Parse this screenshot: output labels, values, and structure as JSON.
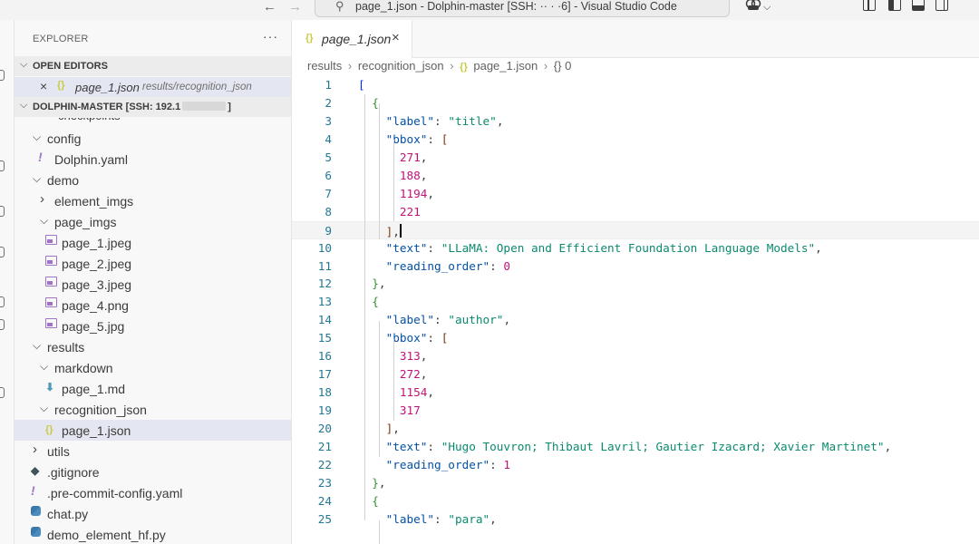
{
  "titlebar": {
    "back_icon": "←",
    "forward_icon": "→",
    "command_center": "page_1.json - Dolphin-master [SSH: ·· ·     ·6] - Visual Studio Code",
    "copilot_icon": "copilot-icon",
    "copilot_chevron": "⌵"
  },
  "explorer": {
    "title": "EXPLORER",
    "more_actions": "···",
    "open_editors": {
      "label": "OPEN EDITORS",
      "items": [
        {
          "name": "page_1.json",
          "path": "results/recognition_json",
          "icon": "{}"
        }
      ]
    },
    "workspace": {
      "label": "DOLPHIN-MASTER [SSH: 192.1",
      "clipped_item": "checkpoints",
      "tree": [
        {
          "name": "config",
          "kind": "folder",
          "open": true,
          "depth": 1
        },
        {
          "name": "Dolphin.yaml",
          "kind": "yaml",
          "depth": 2
        },
        {
          "name": "demo",
          "kind": "folder",
          "open": true,
          "depth": 1
        },
        {
          "name": "element_imgs",
          "kind": "folder",
          "open": false,
          "depth": 2
        },
        {
          "name": "page_imgs",
          "kind": "folder",
          "open": true,
          "depth": 2
        },
        {
          "name": "page_1.jpeg",
          "kind": "image",
          "depth": 3
        },
        {
          "name": "page_2.jpeg",
          "kind": "image",
          "depth": 3
        },
        {
          "name": "page_3.jpeg",
          "kind": "image",
          "depth": 3
        },
        {
          "name": "page_4.png",
          "kind": "image",
          "depth": 3
        },
        {
          "name": "page_5.jpg",
          "kind": "image",
          "depth": 3
        },
        {
          "name": "results",
          "kind": "folder",
          "open": true,
          "depth": 1
        },
        {
          "name": "markdown",
          "kind": "folder",
          "open": true,
          "depth": 2
        },
        {
          "name": "page_1.md",
          "kind": "markdown",
          "depth": 3
        },
        {
          "name": "recognition_json",
          "kind": "folder",
          "open": true,
          "depth": 2
        },
        {
          "name": "page_1.json",
          "kind": "json",
          "depth": 3,
          "selected": true
        },
        {
          "name": "utils",
          "kind": "folder",
          "open": false,
          "depth": 1
        },
        {
          "name": ".gitignore",
          "kind": "git",
          "depth": 1
        },
        {
          "name": ".pre-commit-config.yaml",
          "kind": "yaml",
          "depth": 1
        },
        {
          "name": "chat.py",
          "kind": "python",
          "depth": 1
        },
        {
          "name": "demo_element_hf.py",
          "kind": "python",
          "depth": 1
        }
      ]
    }
  },
  "editor": {
    "tab": {
      "label": "page_1.json",
      "icon": "{}",
      "close": "×"
    },
    "breadcrumb": [
      "results",
      "recognition_json",
      "page_1.json",
      "{} 0"
    ],
    "lines": [
      {
        "n": "1",
        "tokens": [
          [
            "b1",
            "["
          ]
        ]
      },
      {
        "n": "2",
        "tokens": [
          [
            "p",
            "  "
          ],
          [
            "b2",
            "{"
          ]
        ]
      },
      {
        "n": "3",
        "tokens": [
          [
            "p",
            "    "
          ],
          [
            "k",
            "\"label\""
          ],
          [
            "p",
            ": "
          ],
          [
            "s",
            "\"title\""
          ],
          [
            "p",
            ","
          ]
        ]
      },
      {
        "n": "4",
        "tokens": [
          [
            "p",
            "    "
          ],
          [
            "k",
            "\"bbox\""
          ],
          [
            "p",
            ": "
          ],
          [
            "b3",
            "["
          ]
        ]
      },
      {
        "n": "5",
        "tokens": [
          [
            "p",
            "      "
          ],
          [
            "n",
            "271"
          ],
          [
            "p",
            ","
          ]
        ]
      },
      {
        "n": "6",
        "tokens": [
          [
            "p",
            "      "
          ],
          [
            "n",
            "188"
          ],
          [
            "p",
            ","
          ]
        ]
      },
      {
        "n": "7",
        "tokens": [
          [
            "p",
            "      "
          ],
          [
            "n",
            "1194"
          ],
          [
            "p",
            ","
          ]
        ]
      },
      {
        "n": "8",
        "tokens": [
          [
            "p",
            "      "
          ],
          [
            "n",
            "221"
          ]
        ]
      },
      {
        "n": "9",
        "tokens": [
          [
            "p",
            "    "
          ],
          [
            "b3",
            "]"
          ],
          [
            "p",
            ","
          ]
        ],
        "current": true
      },
      {
        "n": "10",
        "tokens": [
          [
            "p",
            "    "
          ],
          [
            "k",
            "\"text\""
          ],
          [
            "p",
            ": "
          ],
          [
            "s",
            "\"LLaMA: Open and Efficient Foundation Language Models\""
          ],
          [
            "p",
            ","
          ]
        ]
      },
      {
        "n": "11",
        "tokens": [
          [
            "p",
            "    "
          ],
          [
            "k",
            "\"reading_order\""
          ],
          [
            "p",
            ": "
          ],
          [
            "n",
            "0"
          ]
        ]
      },
      {
        "n": "12",
        "tokens": [
          [
            "p",
            "  "
          ],
          [
            "b2",
            "}"
          ],
          [
            "p",
            ","
          ]
        ]
      },
      {
        "n": "13",
        "tokens": [
          [
            "p",
            "  "
          ],
          [
            "b2",
            "{"
          ]
        ]
      },
      {
        "n": "14",
        "tokens": [
          [
            "p",
            "    "
          ],
          [
            "k",
            "\"label\""
          ],
          [
            "p",
            ": "
          ],
          [
            "s",
            "\"author\""
          ],
          [
            "p",
            ","
          ]
        ]
      },
      {
        "n": "15",
        "tokens": [
          [
            "p",
            "    "
          ],
          [
            "k",
            "\"bbox\""
          ],
          [
            "p",
            ": "
          ],
          [
            "b3",
            "["
          ]
        ]
      },
      {
        "n": "16",
        "tokens": [
          [
            "p",
            "      "
          ],
          [
            "n",
            "313"
          ],
          [
            "p",
            ","
          ]
        ]
      },
      {
        "n": "17",
        "tokens": [
          [
            "p",
            "      "
          ],
          [
            "n",
            "272"
          ],
          [
            "p",
            ","
          ]
        ]
      },
      {
        "n": "18",
        "tokens": [
          [
            "p",
            "      "
          ],
          [
            "n",
            "1154"
          ],
          [
            "p",
            ","
          ]
        ]
      },
      {
        "n": "19",
        "tokens": [
          [
            "p",
            "      "
          ],
          [
            "n",
            "317"
          ]
        ]
      },
      {
        "n": "20",
        "tokens": [
          [
            "p",
            "    "
          ],
          [
            "b3",
            "]"
          ],
          [
            "p",
            ","
          ]
        ]
      },
      {
        "n": "21",
        "tokens": [
          [
            "p",
            "    "
          ],
          [
            "k",
            "\"text\""
          ],
          [
            "p",
            ": "
          ],
          [
            "s",
            "\"Hugo Touvron; Thibaut Lavril; Gautier Izacard; Xavier Martinet\""
          ],
          [
            "p",
            ","
          ]
        ]
      },
      {
        "n": "22",
        "tokens": [
          [
            "p",
            "    "
          ],
          [
            "k",
            "\"reading_order\""
          ],
          [
            "p",
            ": "
          ],
          [
            "n",
            "1"
          ]
        ]
      },
      {
        "n": "23",
        "tokens": [
          [
            "p",
            "  "
          ],
          [
            "b2",
            "}"
          ],
          [
            "p",
            ","
          ]
        ]
      },
      {
        "n": "24",
        "tokens": [
          [
            "p",
            "  "
          ],
          [
            "b2",
            "{"
          ]
        ]
      },
      {
        "n": "25",
        "tokens": [
          [
            "p",
            "    "
          ],
          [
            "k",
            "\"label\""
          ],
          [
            "p",
            ": "
          ],
          [
            "s",
            "\"para\""
          ],
          [
            "p",
            ","
          ]
        ]
      }
    ]
  }
}
